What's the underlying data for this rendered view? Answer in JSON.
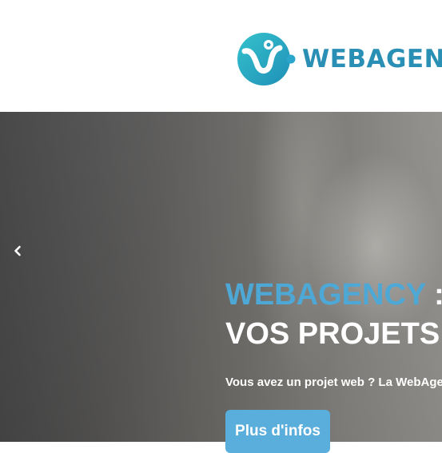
{
  "header": {
    "logo_text": "WEBAGEN",
    "logo_icon": "webagency-logo-mark-icon"
  },
  "hero": {
    "title_accent": "WEBAGENCY",
    "title_separator": " :",
    "title_line2": "VOS PROJETS",
    "subtitle": "Vous avez un projet web ? La WebAge",
    "cta_label": "Plus d'infos",
    "prev_icon": "chevron-left-icon"
  },
  "colors": {
    "brand_teal": "#2a8fb5",
    "accent_blue": "#4ea8d6",
    "button_blue": "#5aaedb",
    "text_white": "#ffffff"
  }
}
